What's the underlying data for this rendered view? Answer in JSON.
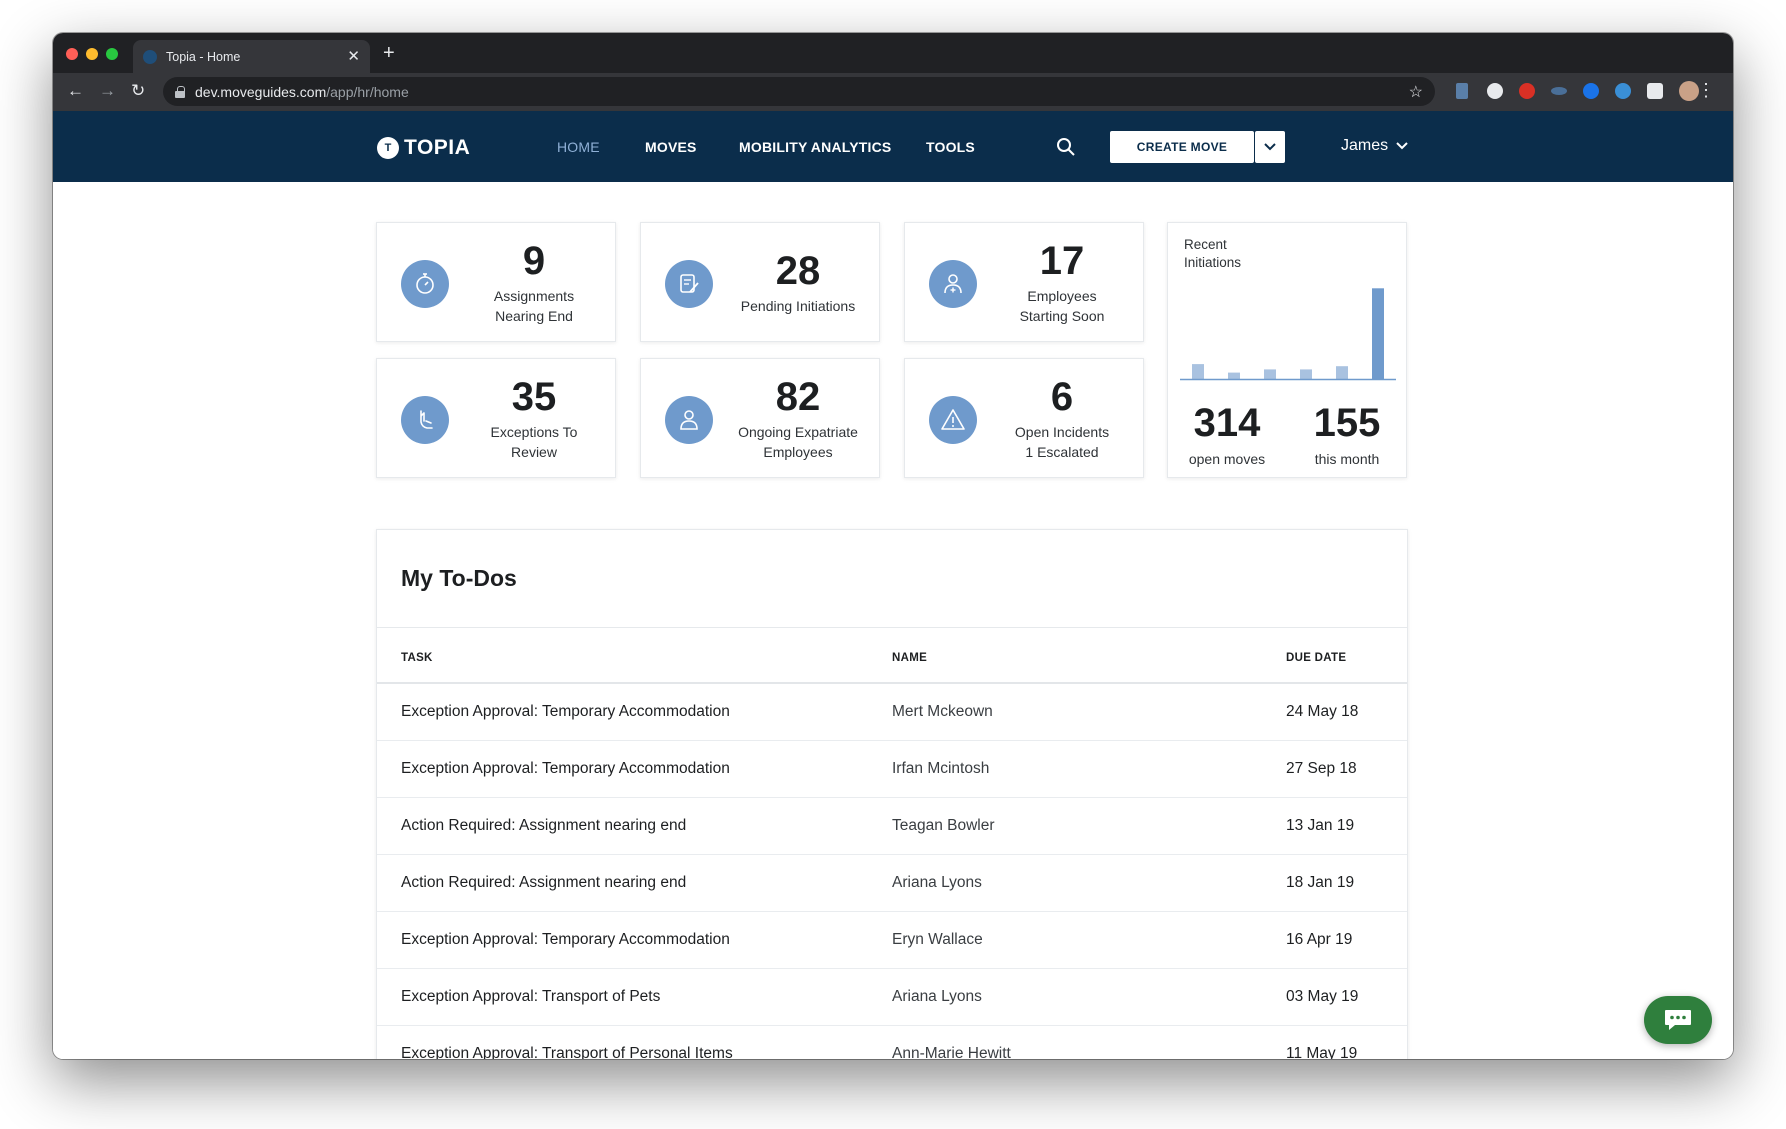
{
  "browser": {
    "tab_title": "Topia - Home",
    "url_host": "dev.moveguides.com",
    "url_path": "/app/hr/home"
  },
  "header": {
    "logo_text": "TOPIA",
    "nav": [
      {
        "label": "HOME",
        "active": true
      },
      {
        "label": "MOVES",
        "active": false
      },
      {
        "label": "MOBILITY ANALYTICS",
        "active": false
      },
      {
        "label": "TOOLS",
        "active": false
      }
    ],
    "create_move_label": "CREATE MOVE",
    "user_name": "James"
  },
  "cards": [
    {
      "value": "9",
      "label_line1": "Assignments",
      "label_line2": "Nearing End",
      "icon": "stopwatch-icon"
    },
    {
      "value": "28",
      "label_line1": "Pending Initiations",
      "label_line2": "",
      "icon": "document-edit-icon"
    },
    {
      "value": "17",
      "label_line1": "Employees",
      "label_line2": "Starting Soon",
      "icon": "user-add-icon"
    },
    {
      "value": "35",
      "label_line1": "Exceptions To",
      "label_line2": "Review",
      "icon": "hand-icon"
    },
    {
      "value": "82",
      "label_line1": "Ongoing Expatriate",
      "label_line2": "Employees",
      "icon": "user-icon"
    },
    {
      "value": "6",
      "label_line1": "Open Incidents",
      "label_line2": "1 Escalated",
      "icon": "warning-icon"
    }
  ],
  "recent": {
    "title": "Recent Initiations",
    "open_moves_value": "314",
    "open_moves_label": "open moves",
    "month_value": "155",
    "month_label": "this month"
  },
  "chart_data": {
    "type": "bar",
    "title": "Recent Initiations",
    "categories": [
      "",
      "",
      "",
      "",
      "",
      ""
    ],
    "values": [
      14,
      6,
      9,
      9,
      12,
      85
    ],
    "ylim": [
      0,
      90
    ],
    "bar_color": "#a9c2e0",
    "highlight_color": "#6f9acc",
    "grid": false
  },
  "todos": {
    "title": "My To-Dos",
    "columns": [
      "TASK",
      "NAME",
      "DUE DATE"
    ],
    "rows": [
      {
        "task": "Exception Approval: Temporary Accommodation",
        "name": "Mert Mckeown",
        "due": "24 May 18"
      },
      {
        "task": "Exception Approval: Temporary Accommodation",
        "name": "Irfan Mcintosh",
        "due": "27 Sep 18"
      },
      {
        "task": "Action Required: Assignment nearing end",
        "name": "Teagan Bowler",
        "due": "13 Jan 19"
      },
      {
        "task": "Action Required: Assignment nearing end",
        "name": "Ariana Lyons",
        "due": "18 Jan 19"
      },
      {
        "task": "Exception Approval: Temporary Accommodation",
        "name": "Eryn Wallace",
        "due": "16 Apr 19"
      },
      {
        "task": "Exception Approval: Transport of Pets",
        "name": "Ariana Lyons",
        "due": "03 May 19"
      },
      {
        "task": "Exception Approval: Transport of Personal Items",
        "name": "Ann-Marie Hewitt",
        "due": "11 May 19"
      }
    ]
  },
  "colors": {
    "header_bg": "#0b2d4b",
    "accent": "#6f9acc",
    "chat_button": "#2f7f3d"
  }
}
